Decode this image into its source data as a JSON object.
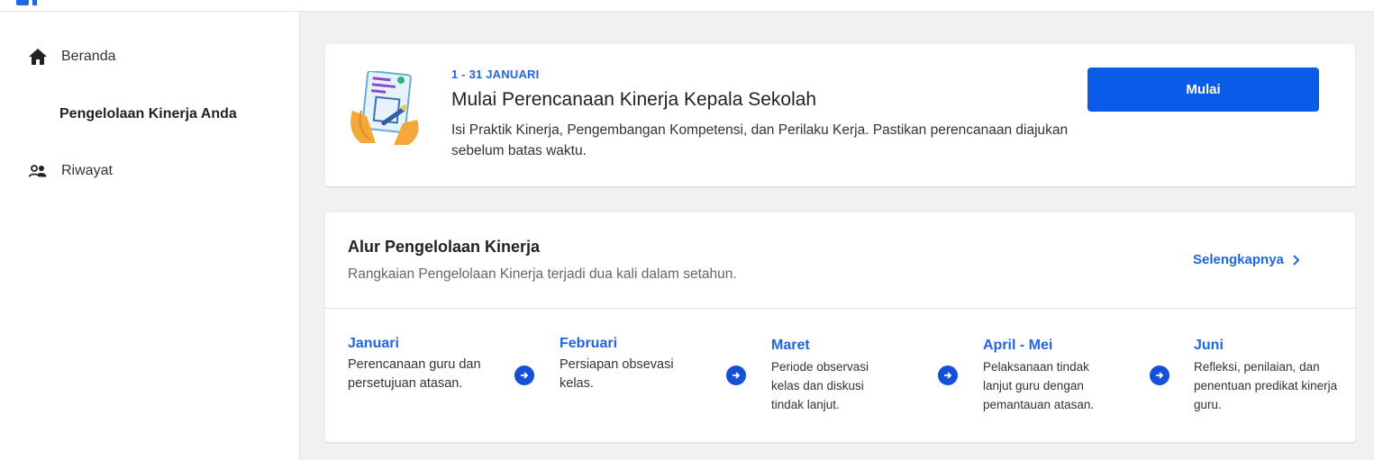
{
  "sidebar": {
    "items": [
      {
        "label": "Beranda",
        "icon": "home-icon"
      },
      {
        "label": "Pengelolaan Kinerja Anda",
        "icon": ""
      },
      {
        "label": "Riwayat",
        "icon": "people-icon"
      }
    ]
  },
  "banner": {
    "date_range": "1 - 31 JANUARI",
    "title": "Mulai Perencanaan Kinerja Kepala Sekolah",
    "description": "Isi Praktik Kinerja, Pengembangan Kompetensi, dan Perilaku Kerja. Pastikan perencanaan diajukan sebelum batas waktu.",
    "button_label": "Mulai",
    "illustration_icon": "clipboard-illustration"
  },
  "flow": {
    "title": "Alur Pengelolaan Kinerja",
    "subtitle": "Rangkaian Pengelolaan Kinerja terjadi dua kali dalam setahun.",
    "more_label": "Selengkapnya",
    "steps": [
      {
        "month": "Januari",
        "desc": "Perencanaan guru dan persetujuan atasan."
      },
      {
        "month": "Februari",
        "desc": "Persiapan obsevasi kelas."
      },
      {
        "month": "Maret",
        "desc": "Periode observasi kelas dan diskusi tindak lanjut."
      },
      {
        "month": "April - Mei",
        "desc": "Pelaksanaan tindak lanjut guru dengan pemantauan atasan."
      },
      {
        "month": "Juni",
        "desc": "Refleksi, penilaian, dan penentuan predikat kinerja guru."
      }
    ]
  },
  "colors": {
    "accent": "#1f66e5",
    "button": "#0a5ce8",
    "background": "#f1f1f1"
  }
}
